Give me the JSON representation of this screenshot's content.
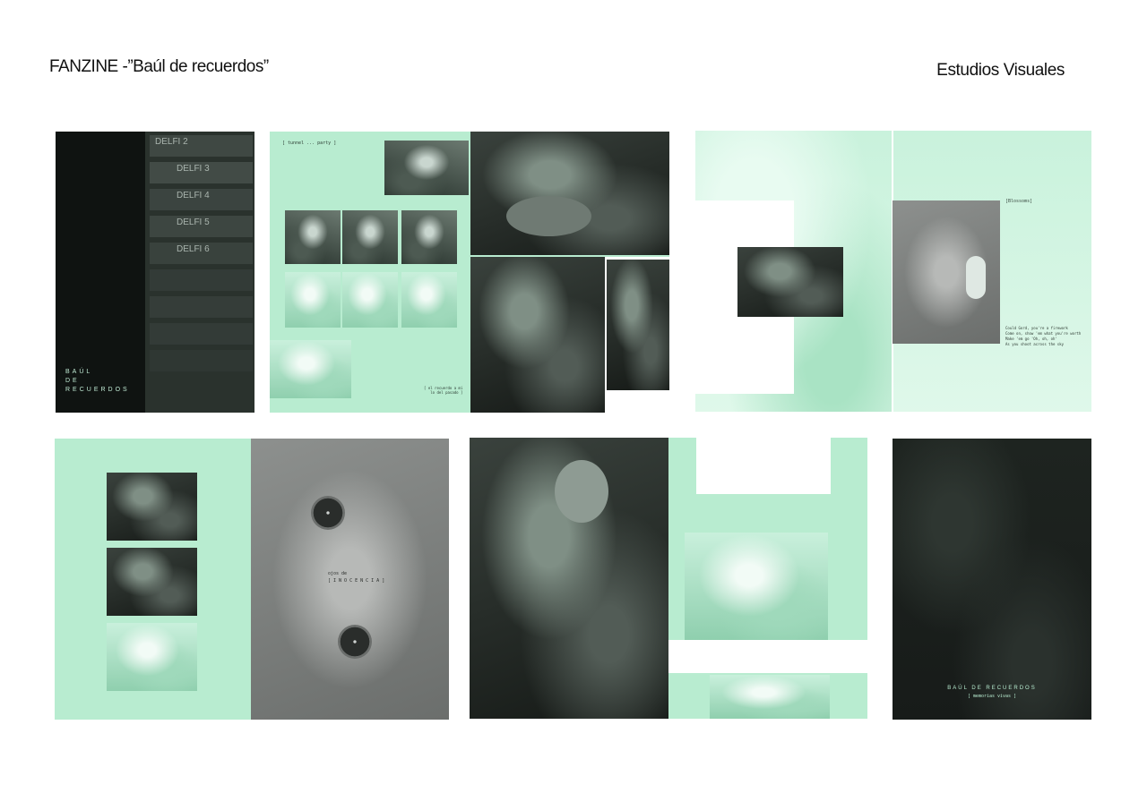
{
  "header": {
    "title": "FANZINE -”Baúl de  recuerdos”",
    "course": "Estudios Visuales"
  },
  "spreads": {
    "cover": {
      "label_lines": [
        "BAÚL",
        "DE",
        "RECUERDOS"
      ],
      "tape_labels": [
        "DELFI 2",
        "DELFI 3",
        "DELFI 4",
        "DELFI 5",
        "DELFI 6"
      ]
    },
    "spread2": {
      "corner_note": "[ tunnel ... party ]",
      "bottom_note": "[ el recuerdo a mi\nlo del pasado ]"
    },
    "spread3": {
      "small_tag": "[Blossoms]",
      "lyric": "Could Gord, you're a firework\nCome on, show 'em what you're worth\nMake 'em go 'Oh, oh, oh'\nAs you shoot across the sky"
    },
    "spread4": {
      "center_line1": "ojos de",
      "center_line2": "[ I N O C E N C I A ]"
    },
    "back": {
      "title": "BAÚL DE RECUERDOS",
      "subtitle": "[ memorias vivas ]"
    }
  },
  "colors": {
    "mint": "#b8ecd0",
    "dark": "#1c211e",
    "grey": "#7e817f"
  }
}
